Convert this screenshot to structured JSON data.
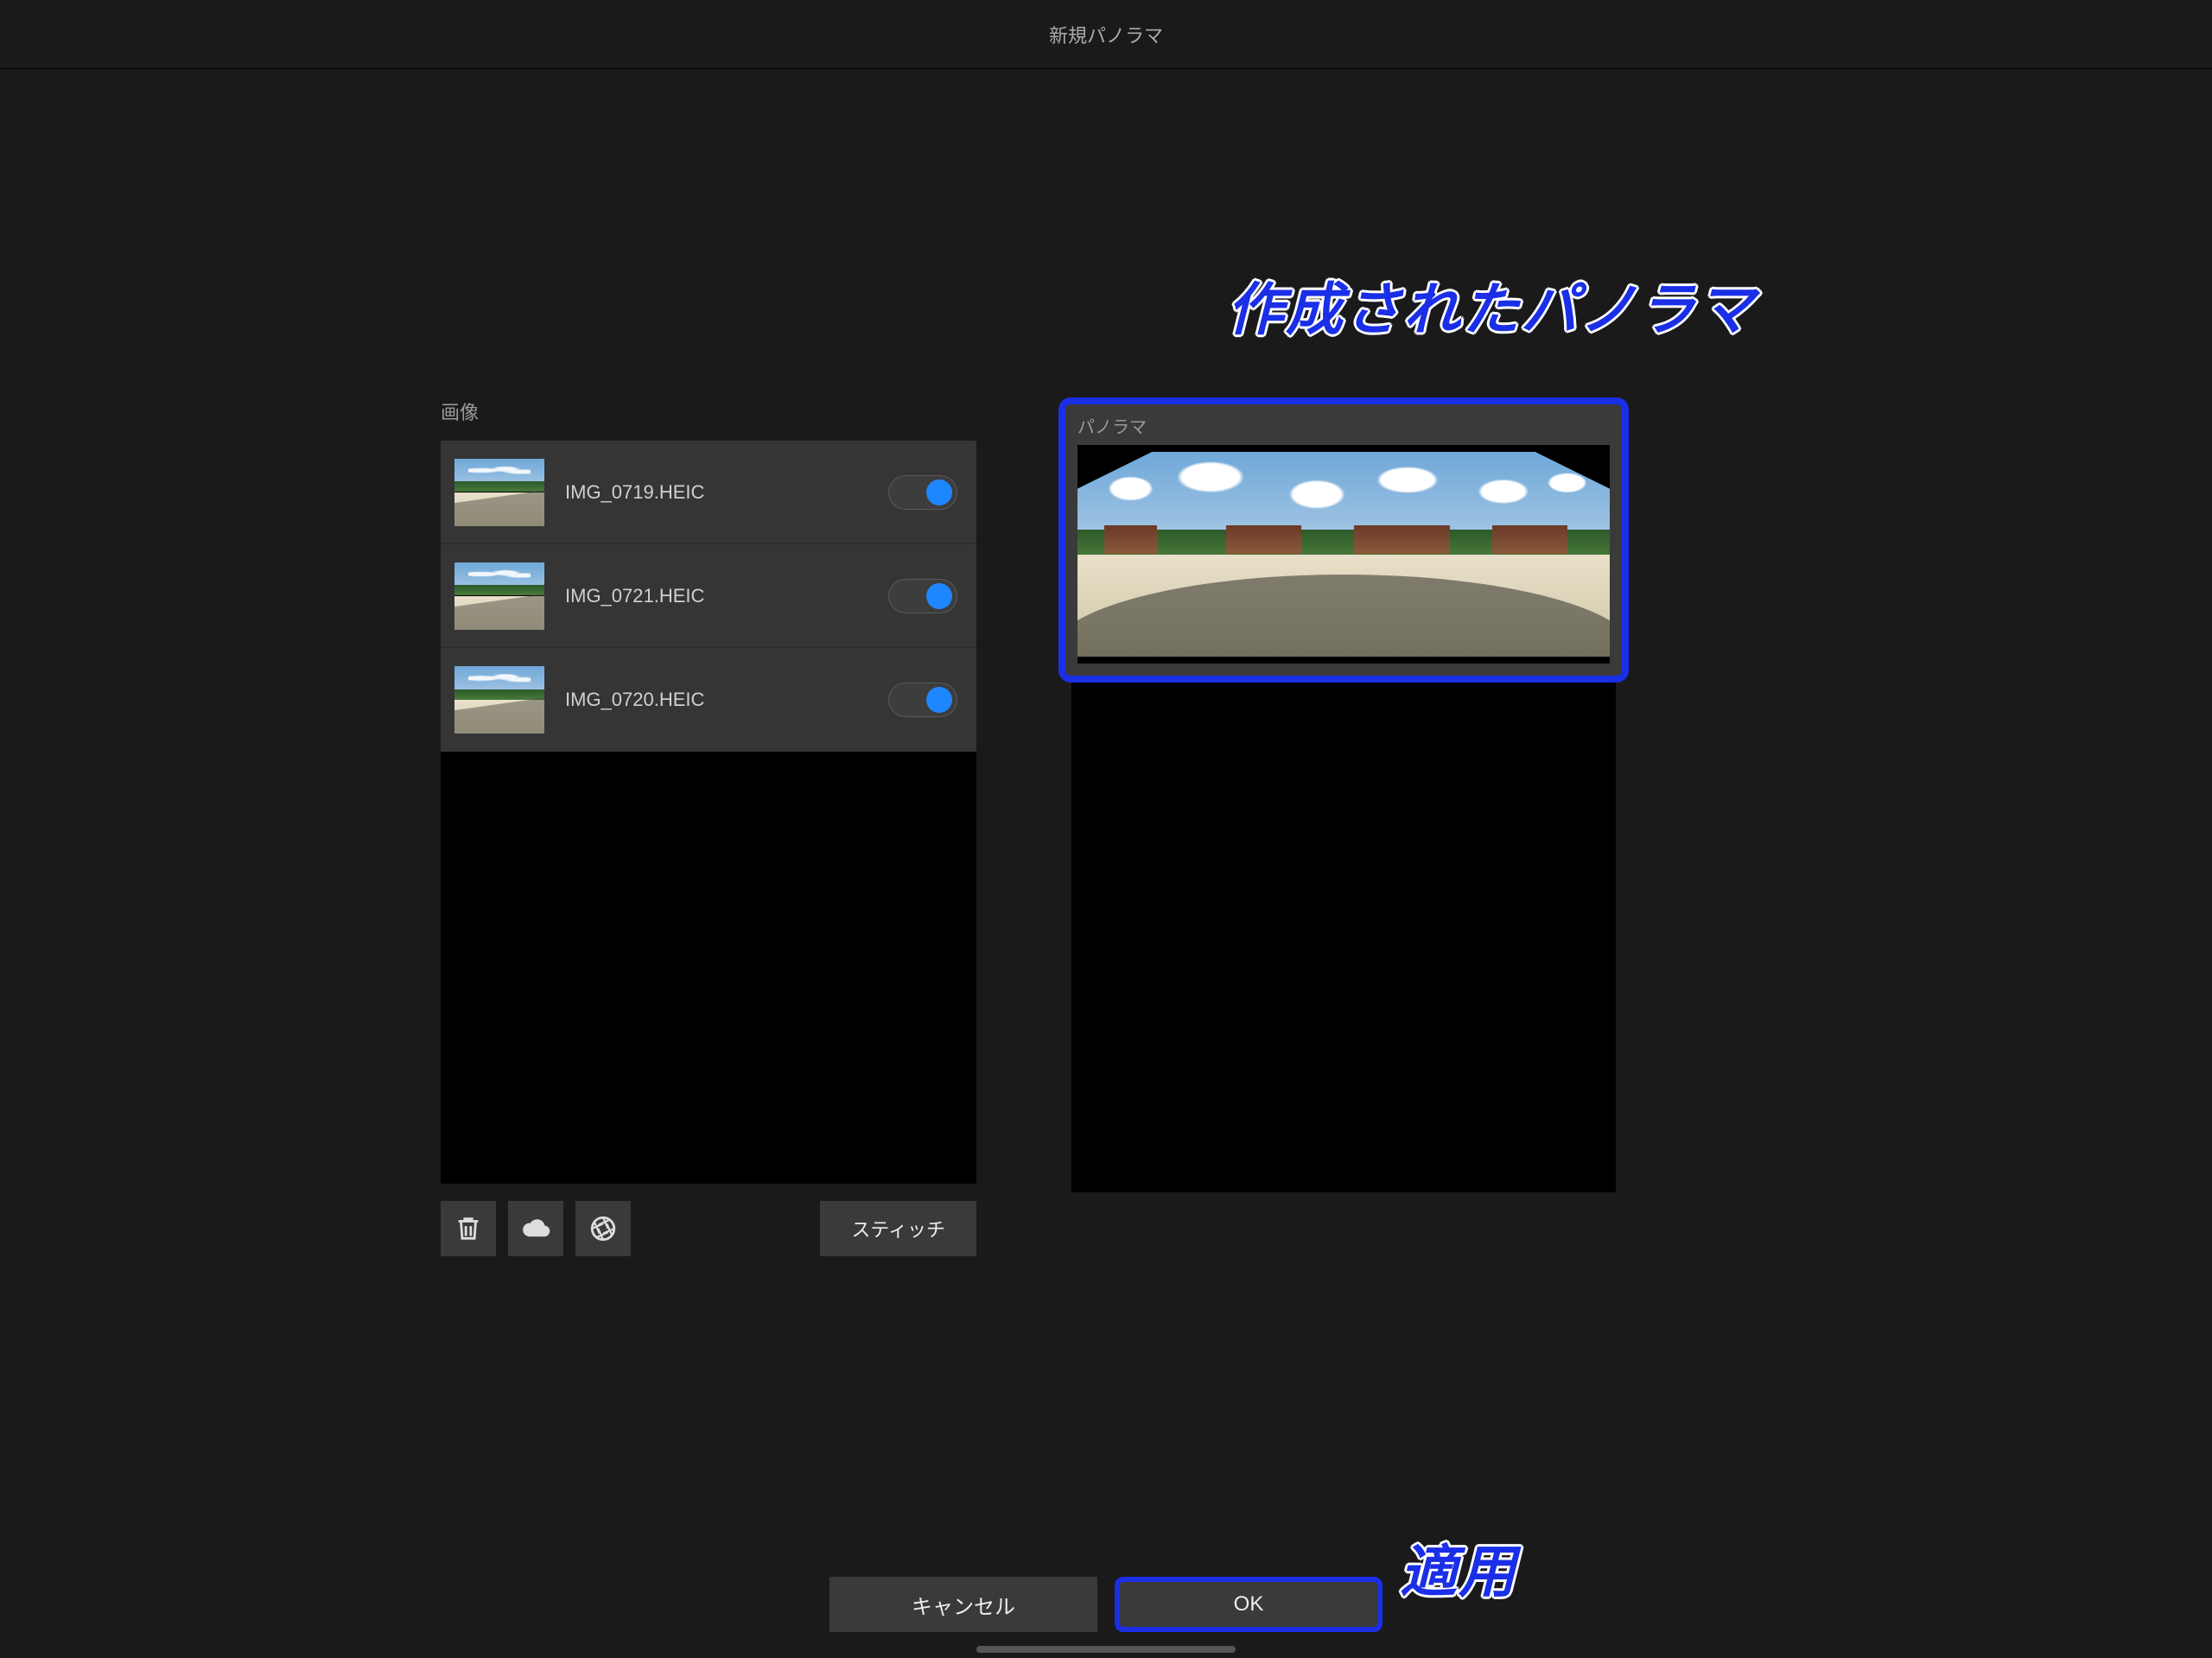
{
  "title": "新規パノラマ",
  "annotations": {
    "created_panorama": "作成されたパノラマ",
    "apply": "適用"
  },
  "left": {
    "heading": "画像",
    "items": [
      {
        "name": "IMG_0719.HEIC",
        "enabled": true
      },
      {
        "name": "IMG_0721.HEIC",
        "enabled": true
      },
      {
        "name": "IMG_0720.HEIC",
        "enabled": true
      }
    ],
    "stitch_button": "スティッチ"
  },
  "right": {
    "heading": "パノラマ"
  },
  "footer": {
    "cancel": "キャンセル",
    "ok": "OK"
  }
}
